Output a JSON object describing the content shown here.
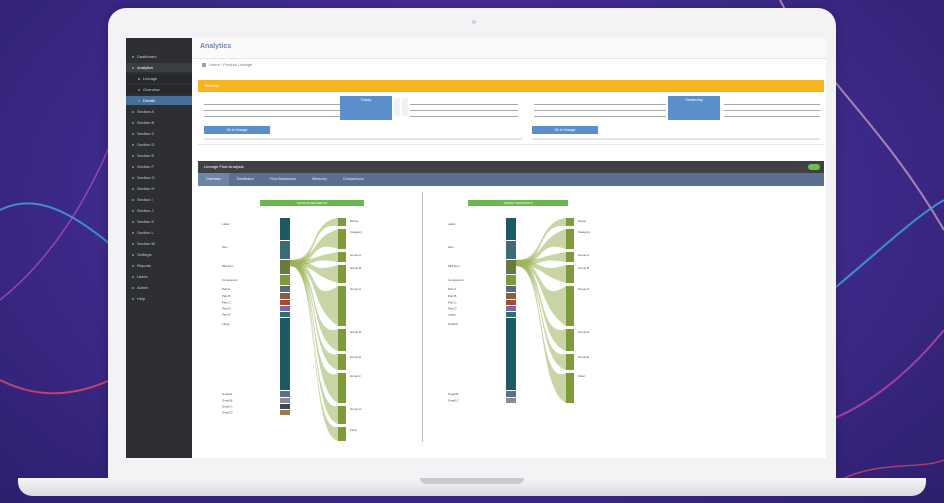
{
  "app": {
    "brand": "Analytics",
    "breadcrumb": "Home / Product Lineage"
  },
  "sidebar": {
    "items": [
      {
        "label": "Dashboard",
        "kind": "top"
      },
      {
        "label": "Analytics",
        "kind": "active"
      },
      {
        "label": "Lineage",
        "kind": "sub"
      },
      {
        "label": "Overview",
        "kind": "sub"
      },
      {
        "label": "Details",
        "kind": "sel"
      },
      {
        "label": "Section A",
        "kind": "top"
      },
      {
        "label": "Section B",
        "kind": "top"
      },
      {
        "label": "Section C",
        "kind": "top"
      },
      {
        "label": "Section D",
        "kind": "top"
      },
      {
        "label": "Section E",
        "kind": "top"
      },
      {
        "label": "Section F",
        "kind": "top"
      },
      {
        "label": "Section G",
        "kind": "top"
      },
      {
        "label": "Section H",
        "kind": "top"
      },
      {
        "label": "Section I",
        "kind": "top"
      },
      {
        "label": "Section J",
        "kind": "top"
      },
      {
        "label": "Section K",
        "kind": "top"
      },
      {
        "label": "Section L",
        "kind": "top"
      },
      {
        "label": "Section M",
        "kind": "top"
      },
      {
        "label": "Settings",
        "kind": "top"
      },
      {
        "label": "Reports",
        "kind": "top"
      },
      {
        "label": "Users",
        "kind": "top"
      },
      {
        "label": "Admin",
        "kind": "top"
      },
      {
        "label": "Help",
        "kind": "top"
      }
    ]
  },
  "timeline": {
    "title": "Timeline",
    "left_highlight": "Today",
    "right_highlight": "Yesterday",
    "left_button": "Go to lineage",
    "right_button": "Go to lineage"
  },
  "lineage": {
    "title": "Lineage Flow Analysis",
    "tabs": [
      "Overview",
      "Distribution",
      "Flow Breakdown",
      "Hierarchy",
      "Comparisons"
    ],
    "left_label": "SOURCE SEGMENTS",
    "right_label": "TARGET SEGMENTS",
    "left_rows": [
      "Label",
      "Item",
      "Mid Item",
      "Component",
      "Part A",
      "Part B",
      "Part C",
      "Part D",
      "Part E",
      "Large",
      "Small A",
      "Small B",
      "Small C",
      "Small D"
    ],
    "left_targets": [
      "Name",
      "Category",
      "Group A",
      "Group B",
      "Group C",
      "Group D",
      "Group E",
      "Group F",
      "Group G",
      "Final"
    ],
    "right_rows": [
      "Label",
      "Item",
      "Mid Item",
      "Component",
      "Part A",
      "Part B",
      "Part C",
      "Part D",
      "Large",
      "Small A",
      "Small B",
      "Small C"
    ],
    "right_targets": [
      "Name",
      "Category",
      "Group A",
      "Group B",
      "Group C",
      "Group D",
      "Group E",
      "Final"
    ]
  },
  "colors": {
    "accent": "#f6b41e",
    "sidebar": "#2d2f33",
    "tabs": "#5a6f91",
    "flow": "#7f9a3a",
    "main_seg": "#1f5866",
    "green_label": "#69b84f",
    "timeline_blue": "#5b8fcb"
  }
}
